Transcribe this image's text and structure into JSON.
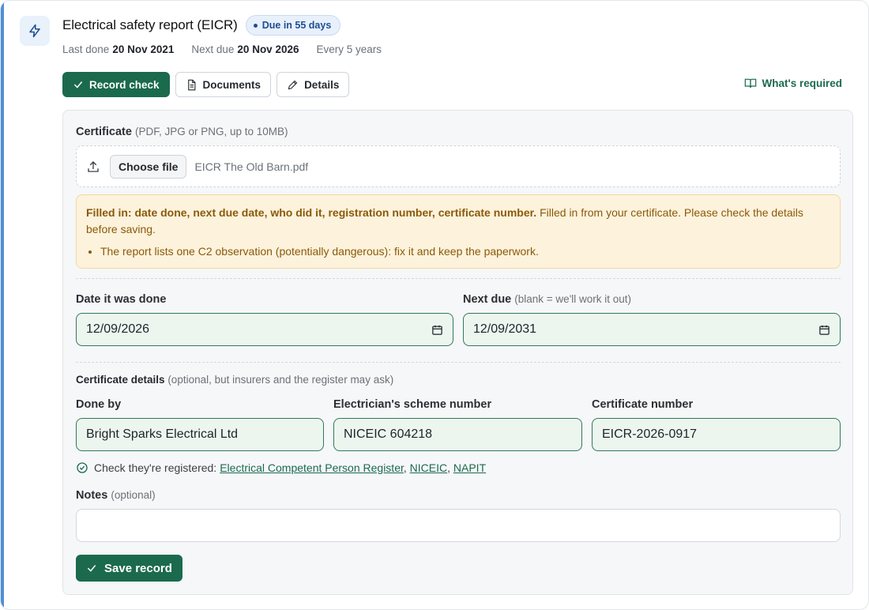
{
  "header": {
    "title": "Electrical safety report (EICR)",
    "badge": "Due in 55 days",
    "last_done_label": "Last done",
    "last_done_value": "20 Nov 2021",
    "next_due_label": "Next due",
    "next_due_value": "20 Nov 2026",
    "frequency": "Every 5 years"
  },
  "actions": {
    "record_check": "Record check",
    "documents": "Documents",
    "details": "Details",
    "whats_required": "What's required"
  },
  "certificate": {
    "label": "Certificate",
    "hint": "(PDF, JPG or PNG, up to 10MB)",
    "choose_file": "Choose file",
    "file_name": "EICR The Old Barn.pdf"
  },
  "notice": {
    "bold": "Filled in: date done, next due date, who did it, registration number, certificate number.",
    "text": " Filled in from your certificate. Please check the details before saving.",
    "items": [
      "The report lists one C2 observation (potentially dangerous): fix it and keep the paperwork."
    ]
  },
  "dates": {
    "done_label": "Date it was done",
    "done_value": "12/09/2026",
    "next_label": "Next due",
    "next_hint": "(blank = we'll work it out)",
    "next_value": "12/09/2031"
  },
  "details": {
    "heading": "Certificate details",
    "heading_hint": "(optional, but insurers and the register may ask)",
    "done_by_label": "Done by",
    "done_by_value": "Bright Sparks Electrical Ltd",
    "scheme_label": "Electrician's scheme number",
    "scheme_value": "NICEIC 604218",
    "cert_no_label": "Certificate number",
    "cert_no_value": "EICR-2026-0917"
  },
  "registers": {
    "prefix": "Check they're registered:",
    "links": [
      "Electrical Competent Person Register",
      "NICEIC",
      "NAPIT"
    ]
  },
  "notes": {
    "label": "Notes",
    "hint": "(optional)",
    "value": ""
  },
  "save_label": "Save record",
  "colors": {
    "brand": "#1b6a4d",
    "accent": "#4f8fd6",
    "warning_bg": "#fdf2dc"
  }
}
